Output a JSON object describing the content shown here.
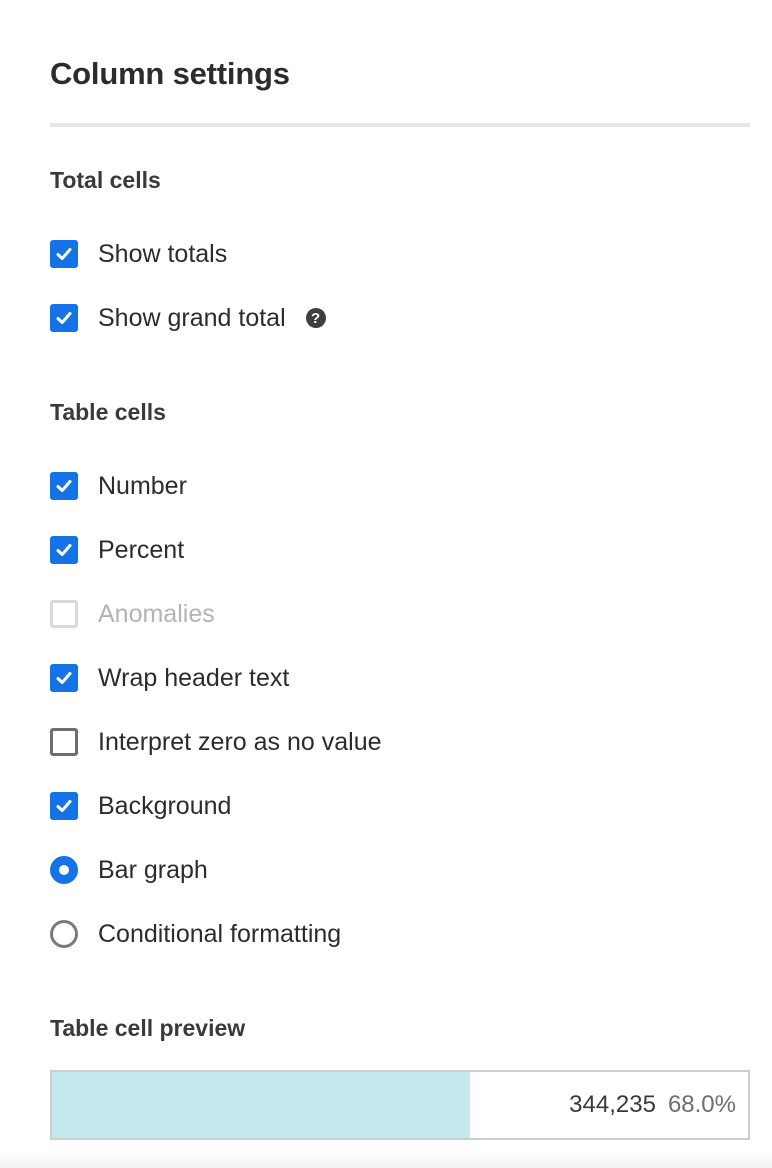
{
  "panel": {
    "title": "Column settings"
  },
  "sections": {
    "total_cells": {
      "heading": "Total cells",
      "options": [
        {
          "label": "Show totals",
          "control": "checkbox",
          "state": "checked"
        },
        {
          "label": "Show grand total",
          "control": "checkbox",
          "state": "checked",
          "help_icon": "question-circle-icon",
          "help_glyph": "?"
        }
      ]
    },
    "table_cells": {
      "heading": "Table cells",
      "options": [
        {
          "label": "Number",
          "control": "checkbox",
          "state": "checked"
        },
        {
          "label": "Percent",
          "control": "checkbox",
          "state": "checked"
        },
        {
          "label": "Anomalies",
          "control": "checkbox",
          "state": "disabled"
        },
        {
          "label": "Wrap header text",
          "control": "checkbox",
          "state": "checked"
        },
        {
          "label": "Interpret zero as no value",
          "control": "checkbox",
          "state": "unchecked"
        },
        {
          "label": "Background",
          "control": "checkbox",
          "state": "checked"
        },
        {
          "label": "Bar graph",
          "control": "radio",
          "state": "selected"
        },
        {
          "label": "Conditional formatting",
          "control": "radio",
          "state": "unselected"
        }
      ]
    },
    "preview": {
      "heading": "Table cell preview",
      "number": "344,235",
      "percent": "68.0%",
      "bar_fraction": 0.6
    }
  },
  "colors": {
    "accent": "#1473e6",
    "bar_fill": "#c4e9ec",
    "border": "#cdcdcd"
  }
}
